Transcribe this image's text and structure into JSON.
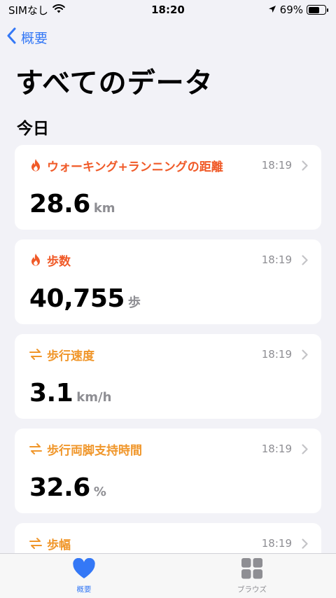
{
  "status_bar": {
    "carrier": "SIMなし",
    "time": "18:20",
    "battery_percent": "69%",
    "battery_level": 0.69,
    "icons": [
      "wifi-icon",
      "location-arrow-icon",
      "battery-icon"
    ]
  },
  "nav": {
    "back_label": "概要"
  },
  "page": {
    "title": "すべてのデータ",
    "section_title": "今日"
  },
  "colors": {
    "accent_blue": "#3478f6",
    "activity_orange": "#f05a28",
    "mobility_amber": "#f0962a",
    "secondary_gray": "#8e8e93",
    "background": "#f2f2f7"
  },
  "cards": [
    {
      "title": "ウォーキング+ランニングの距離",
      "time": "18:19",
      "value": "28.6",
      "unit": "km",
      "icon": "flame-icon",
      "category": "activity"
    },
    {
      "title": "歩数",
      "time": "18:19",
      "value": "40,755",
      "unit": "歩",
      "icon": "flame-icon",
      "category": "activity"
    },
    {
      "title": "歩行速度",
      "time": "18:19",
      "value": "3.1",
      "unit": "km/h",
      "icon": "mobility-arrows-icon",
      "category": "mobility"
    },
    {
      "title": "歩行両脚支持時間",
      "time": "18:19",
      "value": "32.6",
      "unit": "%",
      "icon": "mobility-arrows-icon",
      "category": "mobility"
    },
    {
      "title": "歩幅",
      "time": "18:19",
      "value": "",
      "unit": "",
      "icon": "mobility-arrows-icon",
      "category": "mobility"
    }
  ],
  "tab_bar": {
    "tabs": [
      {
        "label": "概要",
        "icon": "heart-icon",
        "active": true
      },
      {
        "label": "ブラウズ",
        "icon": "grid-icon",
        "active": false
      }
    ]
  }
}
